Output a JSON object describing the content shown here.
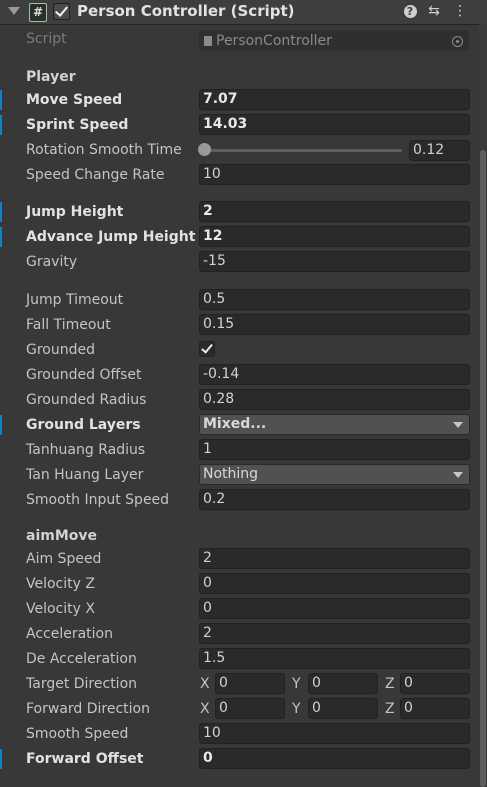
{
  "header": {
    "script_icon": "#",
    "title": "Person Controller (Script)",
    "icons": [
      "fold-arrow-icon",
      "script-icon",
      "help-icon",
      "preset-icon",
      "kebab-menu-icon"
    ]
  },
  "script": {
    "label": "Script",
    "value": "PersonController"
  },
  "sections": {
    "player": "Player",
    "aimMove": "aimMove"
  },
  "fields": {
    "move_speed": {
      "label": "Move Speed",
      "value": "7.07"
    },
    "sprint_speed": {
      "label": "Sprint Speed",
      "value": "14.03"
    },
    "rotation_smooth_time": {
      "label": "Rotation Smooth Time",
      "value": "0.12"
    },
    "speed_change_rate": {
      "label": "Speed Change Rate",
      "value": "10"
    },
    "jump_height": {
      "label": "Jump Height",
      "value": "2"
    },
    "advance_jump_height": {
      "label": "Advance Jump Height",
      "value": "12"
    },
    "gravity": {
      "label": "Gravity",
      "value": "-15"
    },
    "jump_timeout": {
      "label": "Jump Timeout",
      "value": "0.5"
    },
    "fall_timeout": {
      "label": "Fall Timeout",
      "value": "0.15"
    },
    "grounded": {
      "label": "Grounded",
      "value": true
    },
    "grounded_offset": {
      "label": "Grounded Offset",
      "value": "-0.14"
    },
    "grounded_radius": {
      "label": "Grounded Radius",
      "value": "0.28"
    },
    "ground_layers": {
      "label": "Ground Layers",
      "value": "Mixed..."
    },
    "tanhuang_radius": {
      "label": "Tanhuang Radius",
      "value": "1"
    },
    "tan_huang_layer": {
      "label": "Tan Huang Layer",
      "value": "Nothing"
    },
    "smooth_input_speed": {
      "label": "Smooth Input Speed",
      "value": "0.2"
    },
    "aim_speed": {
      "label": "Aim Speed",
      "value": "2"
    },
    "velocity_z": {
      "label": "Velocity Z",
      "value": "0"
    },
    "velocity_x": {
      "label": "Velocity X",
      "value": "0"
    },
    "acceleration": {
      "label": "Acceleration",
      "value": "2"
    },
    "de_acceleration": {
      "label": "De Acceleration",
      "value": "1.5"
    },
    "target_direction": {
      "label": "Target Direction",
      "x": "0",
      "y": "0",
      "z": "0"
    },
    "forward_direction": {
      "label": "Forward Direction",
      "x": "0",
      "y": "0",
      "z": "0"
    },
    "smooth_speed": {
      "label": "Smooth Speed",
      "value": "10"
    },
    "forward_offset": {
      "label": "Forward Offset",
      "value": "0"
    }
  },
  "axis_labels": {
    "x": "X",
    "y": "Y",
    "z": "Z"
  },
  "colors": {
    "override_marker": "#0f81c8",
    "background": "#383838",
    "field": "#2a2a2a"
  }
}
